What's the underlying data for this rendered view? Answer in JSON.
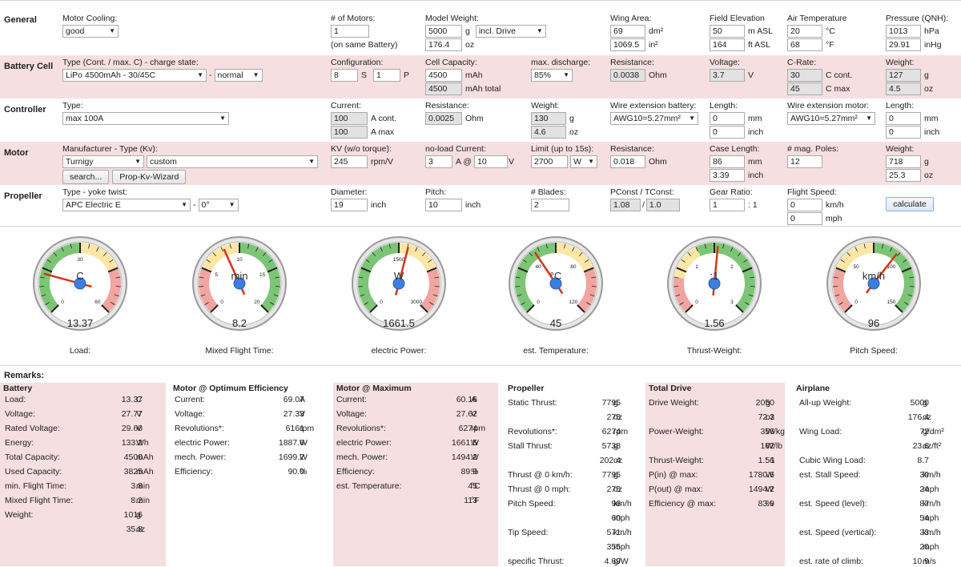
{
  "general": {
    "label": "General",
    "motor_cooling_label": "Motor Cooling:",
    "motor_cooling": "good",
    "num_motors_label": "# of Motors:",
    "num_motors": "1",
    "num_motors_note": "(on same Battery)",
    "model_weight_label": "Model Weight:",
    "model_weight_g": "5000",
    "model_weight_oz": "176.4",
    "weight_mode": "incl. Drive",
    "wing_area_label": "Wing Area:",
    "wing_area_dm": "69",
    "wing_area_in": "1069.5",
    "field_elev_label": "Field Elevation",
    "field_elev_m": "50",
    "field_elev_ft": "164",
    "air_temp_label": "Air Temperature",
    "air_temp_c": "20",
    "air_temp_f": "68",
    "pressure_label": "Pressure (QNH):",
    "pressure_hpa": "1013",
    "pressure_inhg": "29.91",
    "u_g": "g",
    "u_oz": "oz",
    "u_dm2": "dm²",
    "u_in2": "in²",
    "u_masl": "m ASL",
    "u_ftasl": "ft ASL",
    "u_c": "°C",
    "u_f": "°F",
    "u_hpa": "hPa",
    "u_inhg": "inHg"
  },
  "battery": {
    "label": "Battery Cell",
    "type_label": "Type (Cont. / max. C) - charge state:",
    "type": "LiPo 4500mAh - 30/45C",
    "dash": "-",
    "charge": "normal",
    "config_label": "Configuration:",
    "s": "8",
    "s_unit": "S",
    "p": "1",
    "p_unit": "P",
    "capacity_label": "Cell Capacity:",
    "capacity": "4500",
    "capacity_unit": "mAh",
    "capacity_total": "4500",
    "capacity_total_unit": "mAh total",
    "discharge_label": "max. discharge:",
    "discharge": "85%",
    "resistance_label": "Resistance:",
    "resistance": "0.0038",
    "resistance_unit": "Ohm",
    "voltage_label": "Voltage:",
    "voltage": "3.7",
    "voltage_unit": "V",
    "crate_label": "C-Rate:",
    "c_cont": "30",
    "c_cont_unit": "C cont.",
    "c_max": "45",
    "c_max_unit": "C max",
    "weight_label": "Weight:",
    "weight_g": "127",
    "weight_oz": "4.5"
  },
  "controller": {
    "label": "Controller",
    "type_label": "Type:",
    "type": "max 100A",
    "current_label": "Current:",
    "current_cont": "100",
    "current_cont_unit": "A cont.",
    "current_max": "100",
    "current_max_unit": "A max",
    "resistance_label": "Resistance:",
    "resistance": "0.0025",
    "resistance_unit": "Ohm",
    "weight_label": "Weight:",
    "weight_g": "130",
    "weight_oz": "4.6",
    "wire_batt_label": "Wire extension battery:",
    "wire_batt": "AWG10=5.27mm²",
    "length1_label": "Length:",
    "length1_mm": "0",
    "length1_in": "0",
    "wire_motor_label": "Wire extension motor:",
    "wire_motor": "AWG10=5.27mm²",
    "length2_label": "Length:",
    "length2_mm": "0",
    "length2_in": "0",
    "u_mm": "mm",
    "u_inch": "inch"
  },
  "motor": {
    "label": "Motor",
    "type_label": "Manufacturer - Type (Kv):",
    "manufacturer": "Turnigy",
    "type": "custom",
    "search": "search...",
    "wizard": "Prop-Kv-Wizard",
    "kv_label": "KV (w/o torque):",
    "kv": "245",
    "kv_unit": "rpm/V",
    "noload_label": "no-load Current:",
    "noload": "3",
    "noload_at": "A @",
    "noload_v": "10",
    "noload_v_unit": "V",
    "limit_label": "Limit (up to 15s):",
    "limit": "2700",
    "limit_unit": "W",
    "resistance_label": "Resistance:",
    "resistance": "0.018",
    "resistance_unit": "Ohm",
    "case_label": "Case Length:",
    "case_mm": "86",
    "case_in": "3.39",
    "u_mm": "mm",
    "u_inch": "inch",
    "poles_label": "# mag. Poles:",
    "poles": "12",
    "weight_label": "Weight:",
    "weight_g": "718",
    "weight_oz": "25.3"
  },
  "propeller": {
    "label": "Propeller",
    "type_label": "Type - yoke twist:",
    "type": "APC Electric E",
    "dash": "-",
    "twist": "0°",
    "diameter_label": "Diameter:",
    "diameter": "19",
    "diameter_unit": "inch",
    "pitch_label": "Pitch:",
    "pitch": "10",
    "pitch_unit": "inch",
    "blades_label": "# Blades:",
    "blades": "2",
    "pconst_label": "PConst / TConst:",
    "pconst": "1.08",
    "slash": "/",
    "tconst": "1.0",
    "gear_label": "Gear Ratio:",
    "gear": "1",
    "gear_unit": ": 1",
    "speed_label": "Flight Speed:",
    "speed_kmh": "0",
    "speed_mph": "0",
    "u_kmh": "km/h",
    "u_mph": "mph",
    "calculate": "calculate"
  },
  "gauges": [
    {
      "label": "Load:",
      "unit": "C",
      "value": "13.37",
      "ticks": [
        "0",
        "30",
        "60"
      ],
      "needle": 13.37,
      "min": 0,
      "max": 60
    },
    {
      "label": "Mixed Flight Time:",
      "unit": "min",
      "value": "8.2",
      "ticks": [
        "0",
        "5",
        "10",
        "15",
        "20"
      ],
      "needle": 8.2,
      "min": 0,
      "max": 20
    },
    {
      "label": "electric Power:",
      "unit": "W",
      "value": "1661.5",
      "ticks": [
        "0",
        "1500",
        "3000"
      ],
      "needle": 1661.5,
      "min": 0,
      "max": 3000
    },
    {
      "label": "est. Temperature:",
      "unit": "°C",
      "value": "45",
      "ticks": [
        "0",
        "40",
        "80",
        "120"
      ],
      "needle": 45,
      "min": 0,
      "max": 120
    },
    {
      "label": "Thrust-Weight:",
      "unit": ":1",
      "value": "1.56",
      "ticks": [
        "0",
        "1",
        "2",
        "3"
      ],
      "needle": 1.56,
      "min": 0,
      "max": 3
    },
    {
      "label": "Pitch Speed:",
      "unit": "km/h",
      "value": "96",
      "ticks": [
        "0",
        "50",
        "100",
        "150"
      ],
      "needle": 96,
      "min": 0,
      "max": 150
    }
  ],
  "remarks_label": "Remarks:",
  "battery_col": {
    "title": "Battery",
    "rows": [
      {
        "l": "Load:",
        "v": "13.37",
        "u": "C"
      },
      {
        "l": "Voltage:",
        "v": "27.77",
        "u": "V"
      },
      {
        "l": "Rated Voltage:",
        "v": "29.60",
        "u": "V"
      },
      {
        "l": "Energy:",
        "v": "133.2",
        "u": "Wh"
      },
      {
        "l": "Total Capacity:",
        "v": "4500",
        "u": "mAh"
      },
      {
        "l": "Used Capacity:",
        "v": "3825",
        "u": "mAh"
      },
      {
        "l": "min. Flight Time:",
        "v": "3.8",
        "u": "min"
      },
      {
        "l": "Mixed Flight Time:",
        "v": "8.2",
        "u": "min"
      },
      {
        "l": "Weight:",
        "v": "1016",
        "u": "g"
      },
      {
        "l": "",
        "v": "35.8",
        "u": "oz"
      }
    ]
  },
  "opt_col": {
    "title": "Motor @ Optimum Efficiency",
    "rows": [
      {
        "l": "Current:",
        "v": "69.07",
        "u": "A"
      },
      {
        "l": "Voltage:",
        "v": "27.33",
        "u": "V"
      },
      {
        "l": "Revolutions*:",
        "v": "6161",
        "u": "rpm"
      },
      {
        "l": "electric Power:",
        "v": "1887.6",
        "u": "W"
      },
      {
        "l": "mech. Power:",
        "v": "1699.2",
        "u": "W"
      },
      {
        "l": "Efficiency:",
        "v": "90.0",
        "u": "%"
      }
    ]
  },
  "max_col": {
    "title": "Motor @ Maximum",
    "rows": [
      {
        "l": "Current:",
        "v": "60.16",
        "u": "A"
      },
      {
        "l": "Voltage:",
        "v": "27.62",
        "u": "V"
      },
      {
        "l": "Revolutions*:",
        "v": "6274",
        "u": "rpm"
      },
      {
        "l": "electric Power:",
        "v": "1661.5",
        "u": "W"
      },
      {
        "l": "mech. Power:",
        "v": "1494.2",
        "u": "W"
      },
      {
        "l": "Efficiency:",
        "v": "89.9",
        "u": "%"
      },
      {
        "l": "est. Temperature:",
        "v": "45",
        "u": "°C"
      },
      {
        "l": "",
        "v": "113",
        "u": "°F"
      }
    ]
  },
  "prop_col": {
    "title": "Propeller",
    "rows": [
      {
        "l": "Static Thrust:",
        "v": "7795",
        "u": "g"
      },
      {
        "l": "",
        "v": "275",
        "u": "oz"
      },
      {
        "l": "Revolutions*:",
        "v": "6274",
        "u": "rpm"
      },
      {
        "l": "Stall Thrust:",
        "v": "5738",
        "u": "g"
      },
      {
        "l": "",
        "v": "202.4",
        "u": "oz"
      },
      {
        "l": "Thrust @ 0 km/h:",
        "v": "7795",
        "u": "g"
      },
      {
        "l": "Thrust @ 0 mph:",
        "v": "275",
        "u": "oz"
      },
      {
        "l": "Pitch Speed:",
        "v": "96",
        "u": "km/h"
      },
      {
        "l": "",
        "v": "60",
        "u": "mph"
      },
      {
        "l": "Tip Speed:",
        "v": "571",
        "u": "km/h"
      },
      {
        "l": "",
        "v": "355",
        "u": "mph"
      },
      {
        "l": "specific Thrust:",
        "v": "4.69",
        "u": "g/W"
      }
    ]
  },
  "drive_col": {
    "title": "Total Drive",
    "rows": [
      {
        "l": "Drive Weight:",
        "v": "2050",
        "u": "g"
      },
      {
        "l": "",
        "v": "72.3",
        "u": "oz"
      },
      {
        "l": "Power-Weight:",
        "v": "356",
        "u": "W/kg"
      },
      {
        "l": "",
        "v": "162",
        "u": "W/lb"
      },
      {
        "l": "Thrust-Weight:",
        "v": "1.56",
        "u": ": 1"
      },
      {
        "l": "P(in) @ max:",
        "v": "1780.6",
        "u": "W"
      },
      {
        "l": "P(out) @ max:",
        "v": "1494.2",
        "u": "W"
      },
      {
        "l": "Efficiency @ max:",
        "v": "83.9",
        "u": "%"
      }
    ]
  },
  "air_col": {
    "title": "Airplane",
    "rows": [
      {
        "l": "All-up Weight:",
        "v": "5000",
        "u": "g"
      },
      {
        "l": "",
        "v": "176.4",
        "u": "oz"
      },
      {
        "l": "Wing Load:",
        "v": "72",
        "u": "g/dm²"
      },
      {
        "l": "",
        "v": "23.6",
        "u": "oz/ft²"
      },
      {
        "l": "Cubic Wing Load:",
        "v": "8.7",
        "u": ""
      },
      {
        "l": "est. Stall Speed:",
        "v": "39",
        "u": "km/h"
      },
      {
        "l": "",
        "v": "24",
        "u": "mph"
      },
      {
        "l": "est. Speed (level):",
        "v": "87",
        "u": "km/h"
      },
      {
        "l": "",
        "v": "54",
        "u": "mph"
      },
      {
        "l": "est. Speed (vertical):",
        "v": "33",
        "u": "km/h"
      },
      {
        "l": "",
        "v": "20",
        "u": "mph"
      },
      {
        "l": "est. rate of climb:",
        "v": "10.9",
        "u": "m/s"
      }
    ]
  }
}
